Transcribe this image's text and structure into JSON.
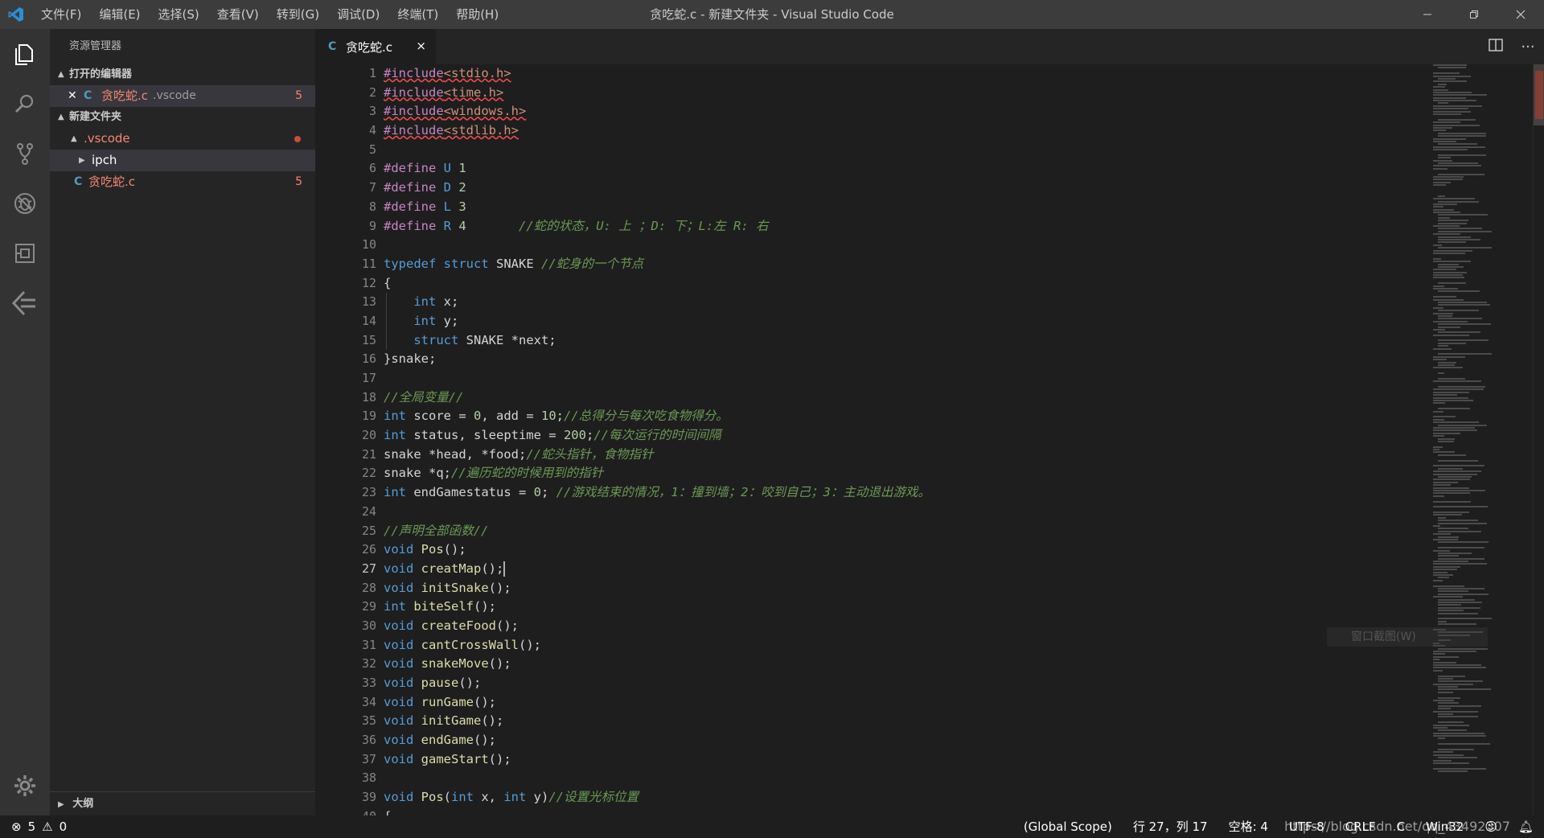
{
  "window": {
    "title": "贪吃蛇.c - 新建文件夹 - Visual Studio Code"
  },
  "menu": [
    "文件(F)",
    "编辑(E)",
    "选择(S)",
    "查看(V)",
    "转到(G)",
    "调试(D)",
    "终端(T)",
    "帮助(H)"
  ],
  "sidebar": {
    "title": "资源管理器",
    "open_editors_label": "打开的编辑器",
    "open_editor_file": "贪吃蛇.c",
    "open_editor_folder": ".vscode",
    "open_editor_count": "5",
    "folder_label": "新建文件夹",
    "tree": {
      "vscode": ".vscode",
      "ipch": "ipch",
      "file": "贪吃蛇.c",
      "file_count": "5"
    },
    "outline_label": "大纲"
  },
  "tab": {
    "name": "贪吃蛇.c",
    "badge": "C",
    "close": "×"
  },
  "editor": {
    "active_line": 27,
    "line_count": 40
  },
  "hover_tip": "窗口截图(W)",
  "status": {
    "errors": "5",
    "warnings": "0",
    "scope": "(Global Scope)",
    "position": "行 27，列 17",
    "spaces": "空格: 4",
    "encoding": "UTF-8",
    "eol": "CRLF",
    "language": "C",
    "platform": "Win32",
    "watermark": "https://blog.csdn.net/qq_43492307"
  },
  "colors": {
    "accent": "#007acc",
    "error": "#f48771",
    "keyword": "#569cd6",
    "comment": "#6a9955"
  }
}
